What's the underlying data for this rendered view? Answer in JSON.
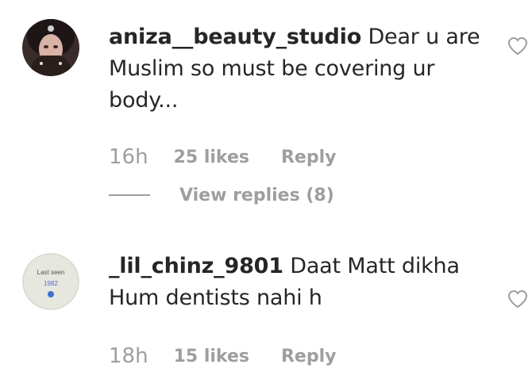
{
  "comments": [
    {
      "username": "aniza__beauty_studio",
      "text": "Dear u are Muslim so must be covering ur body...",
      "time": "16h",
      "likes": "25 likes",
      "reply": "Reply",
      "view_replies": "View replies (8)"
    },
    {
      "username": "_lil_chinz_9801",
      "text": "Daat Matt dikha Hum dentists nahi h",
      "time": "18h",
      "likes": "15 likes",
      "reply": "Reply",
      "avatar_text": [
        "Last seen",
        "1982"
      ]
    }
  ],
  "icons": {
    "like": "heart-outline-icon"
  },
  "colors": {
    "text": "#262626",
    "secondary": "#9e9e9e"
  }
}
